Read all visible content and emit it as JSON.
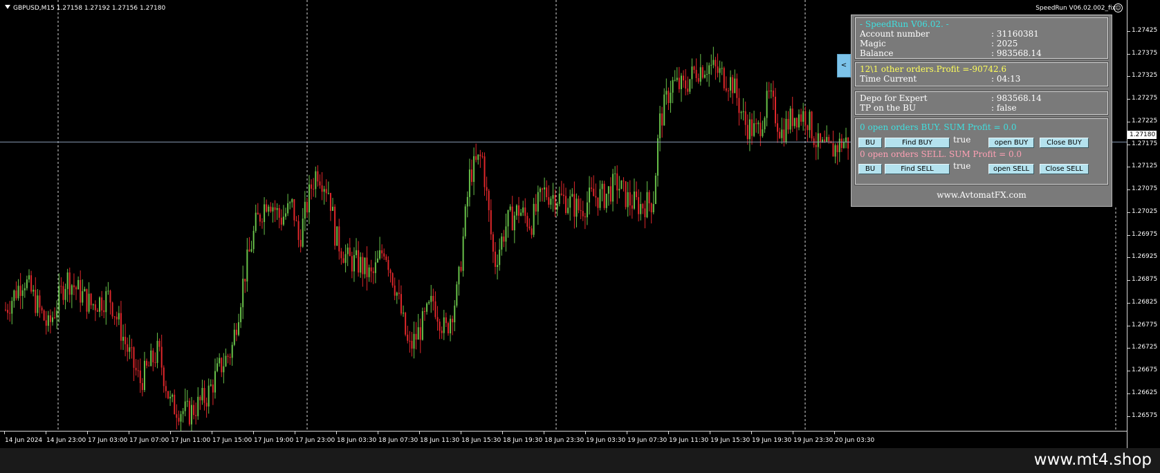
{
  "chart": {
    "header": {
      "symbol": "GBPUSD,M15",
      "ohlc": "1.27158 1.27192 1.27156 1.27180"
    },
    "ea_label": "SpeedRun V06.02.002_fix",
    "current_price": "1.27180",
    "colors": {
      "background": "#000000",
      "bull": "#69c24a",
      "bear": "#e0272b",
      "grid": "#d9d9d9",
      "bid_line": "#8a9bb5"
    },
    "price_axis": {
      "min": 1.2655,
      "max": 1.2746,
      "labels": [
        "1.27425",
        "1.27375",
        "1.27325",
        "1.27275",
        "1.27225",
        "1.27175",
        "1.27125",
        "1.27075",
        "1.27025",
        "1.26975",
        "1.26925",
        "1.26875",
        "1.26825",
        "1.26775",
        "1.26725",
        "1.26675",
        "1.26625",
        "1.26575"
      ]
    },
    "time_labels": [
      "14 Jun 2024",
      "14 Jun 23:00",
      "17 Jun 03:00",
      "17 Jun 07:00",
      "17 Jun 11:00",
      "17 Jun 15:00",
      "17 Jun 19:00",
      "17 Jun 23:00",
      "18 Jun 03:30",
      "18 Jun 07:30",
      "18 Jun 11:30",
      "18 Jun 15:30",
      "18 Jun 19:30",
      "18 Jun 23:30",
      "19 Jun 03:30",
      "19 Jun 07:30",
      "19 Jun 11:30",
      "19 Jun 15:30",
      "19 Jun 19:30",
      "19 Jun 23:30",
      "20 Jun 03:30"
    ],
    "day_separators": [
      1,
      7,
      13,
      19
    ],
    "price_path": [
      [
        0,
        1.2681
      ],
      [
        3,
        1.2688
      ],
      [
        7,
        1.2677
      ],
      [
        10,
        1.2688
      ],
      [
        14,
        1.2682
      ],
      [
        17,
        1.2684
      ],
      [
        20,
        1.2672
      ],
      [
        22,
        1.2665
      ],
      [
        25,
        1.2672
      ],
      [
        27,
        1.266
      ],
      [
        30,
        1.2658
      ],
      [
        33,
        1.2662
      ],
      [
        35,
        1.2668
      ],
      [
        37,
        1.2672
      ],
      [
        39,
        1.2688
      ],
      [
        41,
        1.27
      ],
      [
        43,
        1.2706
      ],
      [
        45,
        1.2701
      ],
      [
        47,
        1.2704
      ],
      [
        48,
        1.2696
      ],
      [
        50,
        1.2708
      ],
      [
        51,
        1.2712
      ],
      [
        53,
        1.2707
      ],
      [
        54,
        1.2697
      ],
      [
        56,
        1.2692
      ],
      [
        58,
        1.2691
      ],
      [
        60,
        1.2688
      ],
      [
        62,
        1.2695
      ],
      [
        64,
        1.2685
      ],
      [
        66,
        1.2672
      ],
      [
        68,
        1.2677
      ],
      [
        70,
        1.2683
      ],
      [
        72,
        1.2676
      ],
      [
        74,
        1.2685
      ],
      [
        76,
        1.2711
      ],
      [
        78,
        1.2715
      ],
      [
        80,
        1.2691
      ],
      [
        82,
        1.27
      ],
      [
        84,
        1.2703
      ],
      [
        86,
        1.27
      ],
      [
        88,
        1.2707
      ],
      [
        90,
        1.2706
      ],
      [
        92,
        1.2705
      ],
      [
        94,
        1.2703
      ],
      [
        96,
        1.2706
      ],
      [
        98,
        1.2706
      ],
      [
        100,
        1.2709
      ],
      [
        102,
        1.2705
      ],
      [
        104,
        1.2704
      ],
      [
        106,
        1.2705
      ],
      [
        107,
        1.2722
      ],
      [
        109,
        1.2731
      ],
      [
        111,
        1.273
      ],
      [
        113,
        1.2734
      ],
      [
        115,
        1.2735
      ],
      [
        117,
        1.2733
      ],
      [
        119,
        1.2731
      ],
      [
        121,
        1.2722
      ],
      [
        123,
        1.272
      ],
      [
        125,
        1.2728
      ],
      [
        127,
        1.272
      ],
      [
        129,
        1.2724
      ],
      [
        131,
        1.2724
      ],
      [
        133,
        1.2717
      ],
      [
        135,
        1.2716
      ],
      [
        137,
        1.2718
      ],
      [
        138,
        1.2718
      ]
    ]
  },
  "toggle": {
    "label": "<"
  },
  "panel": {
    "title": " - SpeedRun V06.02. -",
    "account_label": "Account number",
    "account_value": ": 31160381",
    "magic_label": "Magic",
    "magic_value": ": 2025",
    "balance_label": "Balance",
    "balance_value": ": 983568.14",
    "other_orders": "12\\1 other orders.Profit =-90742.6",
    "time_label": "Time Current",
    "time_value": ": 04:13",
    "depo_label": "Depo for Expert",
    "depo_value": ": 983568.14",
    "tp_label": "TP on the BU",
    "tp_value": ": false",
    "buy_status": "0 open orders BUY. SUM Profit = 0.0",
    "sell_status": "0 open orders SELL. SUM Profit = 0.0",
    "buy_buttons": {
      "bu": "BU",
      "find": "Find BUY",
      "flag": "true",
      "open": "open BUY",
      "close": "Close BUY"
    },
    "sell_buttons": {
      "bu": "BU",
      "find": "Find SELL",
      "flag": "true",
      "open": "open SELL",
      "close": "Close SELL"
    },
    "footer": "www.AvtomatFX.com"
  },
  "watermark": "www.mt4.shop"
}
